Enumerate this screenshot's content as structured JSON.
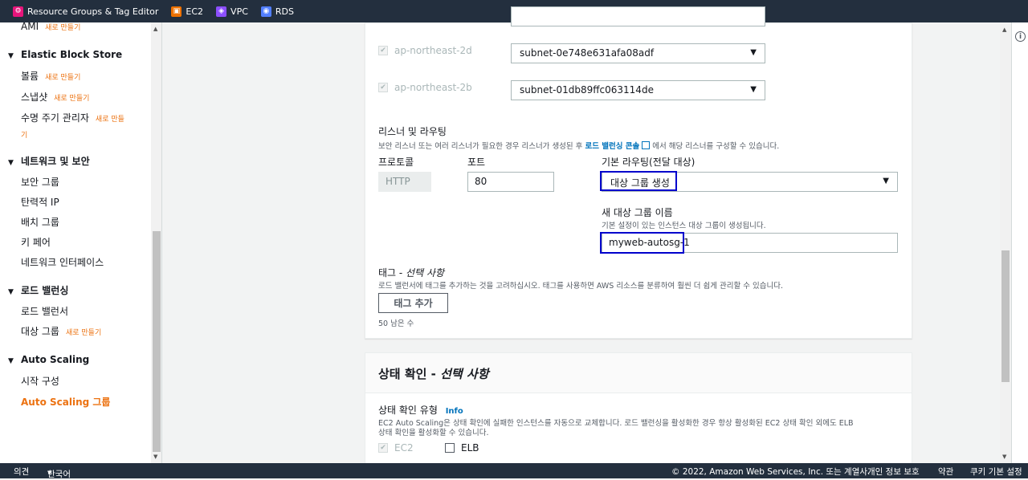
{
  "favorites": [
    {
      "label": "Resource Groups & Tag Editor",
      "icon": "resource-groups-icon",
      "color": "#e7157b"
    },
    {
      "label": "EC2",
      "icon": "ec2-icon",
      "color": "#ed7100"
    },
    {
      "label": "VPC",
      "icon": "vpc-icon",
      "color": "#8c4fff"
    },
    {
      "label": "RDS",
      "icon": "rds-icon",
      "color": "#527fff"
    }
  ],
  "sidebar": {
    "ami": {
      "label": "AMI",
      "new": "새로 만들기"
    },
    "ebs": {
      "heading": "Elastic Block Store",
      "volumes": "볼륨",
      "volumes_new": "새로 만들기",
      "snapshots": "스냅샷",
      "snapshots_new": "새로 만들기",
      "lifecycle": "수명 주기 관리자",
      "lifecycle_new": "새로 만들",
      "lifecycle_new2": "기"
    },
    "network": {
      "heading": "네트워크 및 보안",
      "sg": "보안 그룹",
      "eip": "탄력적 IP",
      "placement": "배치 그룹",
      "keypair": "키 페어",
      "eni": "네트워크 인터페이스"
    },
    "lb": {
      "heading": "로드 밸런싱",
      "lbs": "로드 밸런서",
      "tg": "대상 그룹",
      "tg_new": "새로 만들기"
    },
    "asg": {
      "heading": "Auto Scaling",
      "lc": "시작 구성",
      "groups": "Auto Scaling 그룹"
    }
  },
  "subnets": [
    {
      "az": "ap-northeast-2d",
      "subnet": "subnet-0e748e631afa08adf"
    },
    {
      "az": "ap-northeast-2b",
      "subnet": "subnet-01db89ffc063114de"
    }
  ],
  "listener": {
    "title": "리스너 및 라우팅",
    "desc_before": "보안 리스너 또는 여러 리스너가 필요한 경우 리스너가 생성된 후",
    "desc_link": "로드 밸런싱 콘솔",
    "desc_after": "에서 해당 리스너를 구성할 수 있습니다.",
    "protocol_label": "프로토콜",
    "protocol_value": "HTTP",
    "port_label": "포트",
    "port_value": "80",
    "routing_label": "기본 라우팅(전달 대상)",
    "routing_value": "대상 그룹 생성",
    "new_tg_label": "새 대상 그룹 이름",
    "new_tg_desc": "기본 설정이 있는 인스턴스 대상 그룹이 생성됩니다.",
    "new_tg_value": "myweb-autosg-1"
  },
  "tags": {
    "title": "태그 - ",
    "title_optional": "선택 사항",
    "desc": "로드 밸런서에 태그를 추가하는 것을 고려하십시오. 태그를 사용하면 AWS 리소스를 분류하여 훨씬 더 쉽게 관리할 수 있습니다.",
    "add_button": "태그 추가",
    "remaining": "50 남은 수"
  },
  "health": {
    "title": "상태 확인 - ",
    "title_optional": "선택 사항",
    "type_label": "상태 확인 유형",
    "info": "Info",
    "desc1": "EC2 Auto Scaling은 상태 확인에 실패한 인스턴스를 자동으로 교체합니다. 로드 밸런싱을 활성화한 경우 항상 활성화된 EC2 상태 확인 외에도 ELB",
    "desc2": "상태 확인을 활성화할 수 있습니다.",
    "ec2": "EC2",
    "elb": "ELB"
  },
  "footer": {
    "feedback": "의견",
    "language": "한국어",
    "copyright": "© 2022, Amazon Web Services, Inc. 또는 계열사.",
    "privacy": "개인 정보 보호",
    "terms": "약관",
    "cookies": "쿠키 기본 설정"
  }
}
